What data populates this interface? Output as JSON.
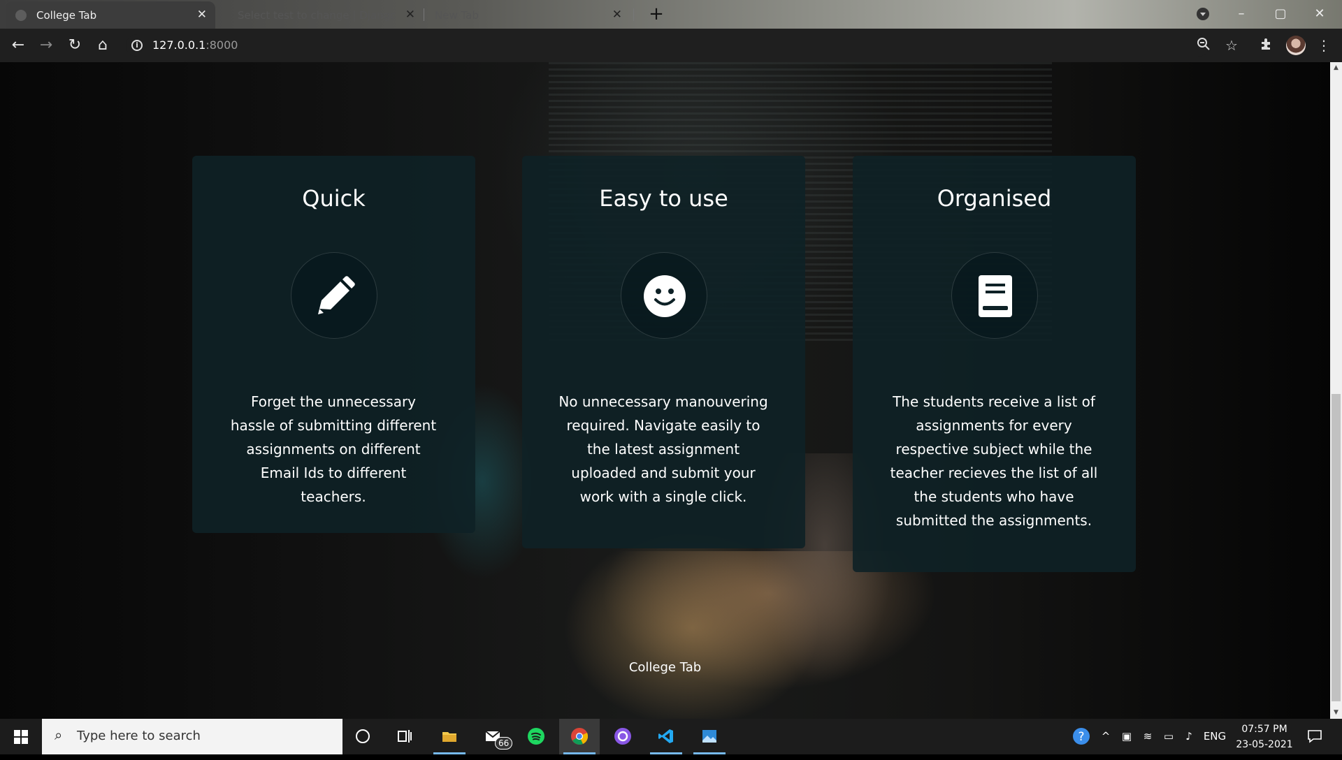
{
  "browser": {
    "tabs": [
      {
        "title": "College Tab",
        "active": true
      },
      {
        "title": "Select test to change | Django si",
        "active": false
      },
      {
        "title": "New Tab",
        "active": false
      }
    ],
    "url_host": "127.0.0.1",
    "url_port": ":8000"
  },
  "page": {
    "features": [
      {
        "title": "Quick",
        "icon": "pencil-icon",
        "text": "Forget the unnecessary hassle of submitting different assignments on different Email Ids to different teachers."
      },
      {
        "title": "Easy to use",
        "icon": "smiley-icon",
        "text": "No unnecessary manouvering required. Navigate easily to the latest assignment uploaded and submit your work with a single click."
      },
      {
        "title": "Organised",
        "icon": "book-icon",
        "text": "The students receive a list of assignments for every respective subject while the teacher recieves the list of all the students who have submitted the assignments."
      }
    ],
    "footer": "College Tab"
  },
  "taskbar": {
    "search_placeholder": "Type here to search",
    "mail_badge": "66",
    "language": "ENG",
    "time": "07:57 PM",
    "date": "23-05-2021"
  }
}
